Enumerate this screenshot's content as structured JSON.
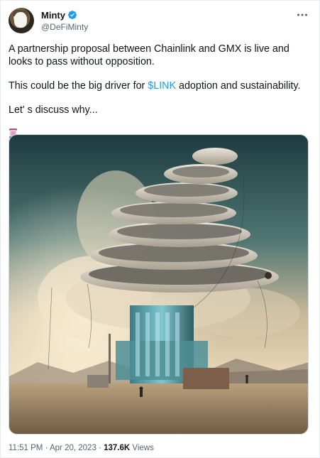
{
  "tweet": {
    "author": {
      "display_name": "Minty",
      "handle": "@DeFiMinty",
      "verified": true
    },
    "more_icon": "more-icon",
    "paragraphs": [
      "A partnership proposal between Chainlink and GMX is live and looks to pass without opposition.",
      "This could be the big driver for",
      "Let' s discuss why..."
    ],
    "cashtag": "$LINK",
    "paragraph2_tail": " adoption and sustainability.",
    "emoji_icon": "scroll-emoji",
    "media_description": "",
    "time": "11:51 PM",
    "date": "Apr 20, 2023",
    "separator": "·",
    "views_count": "137.6K",
    "views_label": "Views"
  },
  "colors": {
    "accent": "#1d9bf0",
    "text": "#0f1419",
    "secondary": "#536471",
    "border": "#cfd9de"
  }
}
